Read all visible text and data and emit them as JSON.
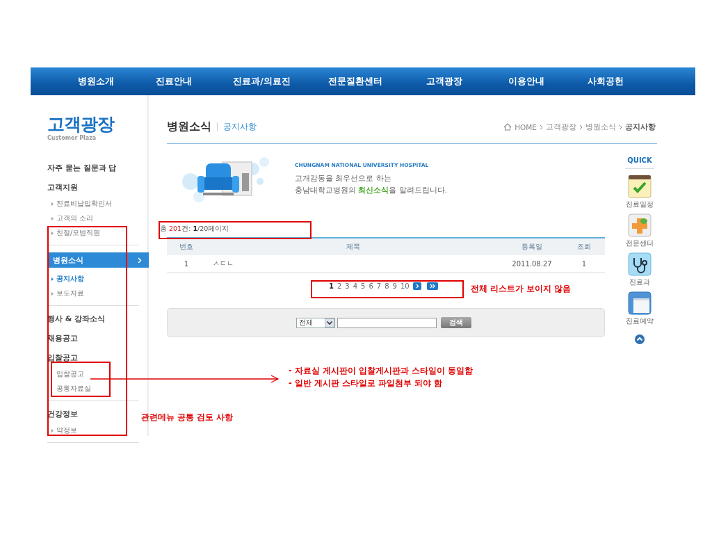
{
  "nav": [
    "병원소개",
    "진료안내",
    "진료과/의료진",
    "전문질환센터",
    "고객광장",
    "이용안내",
    "사회공헌"
  ],
  "sidebar": {
    "title": "고객광장",
    "subtitle": "Customer Plaza",
    "items": [
      {
        "label": "자주 묻는 질문과 답",
        "selected": false
      },
      {
        "label": "고객지원",
        "selected": false,
        "children": [
          {
            "label": "진료비납입확인서",
            "selected": false,
            "kind": "bullet"
          },
          {
            "label": "고객의 소리",
            "selected": false,
            "kind": "bullet"
          },
          {
            "label": "친절/모범직원",
            "selected": false,
            "kind": "bullet"
          }
        ]
      },
      {
        "label": "병원소식",
        "selected": true,
        "children": [
          {
            "label": "공지사항",
            "selected": true,
            "kind": "bullet"
          },
          {
            "label": "보도자료",
            "selected": false,
            "kind": "bullet"
          }
        ]
      },
      {
        "label": "행사 & 강좌소식",
        "selected": false
      },
      {
        "label": "채용공고",
        "selected": false
      },
      {
        "label": "입찰공고",
        "selected": false,
        "children": [
          {
            "label": "입찰공고",
            "selected": false,
            "kind": "plain"
          },
          {
            "label": "공통자료실",
            "selected": false,
            "kind": "plain"
          }
        ]
      },
      {
        "label": "건강정보",
        "selected": false,
        "children": [
          {
            "label": "약정보",
            "selected": false,
            "kind": "bullet"
          }
        ]
      }
    ]
  },
  "page_header": {
    "title": "병원소식",
    "subtitle": "공지사항",
    "breadcrumb": [
      "HOME",
      "고객광장",
      "병원소식",
      "공지사항"
    ]
  },
  "banner": {
    "eyebrow": "CHUNGNAM NATIONAL UNIVERSITY HOSPITAL",
    "lines": [
      "고개감동을 최우선으로 하는",
      "충남대학교병원의 **최신소식**을 알려드립니다."
    ]
  },
  "summary": "총 **201**건: **1**/20페이지",
  "table": {
    "columns": [
      "번호",
      "제목",
      "등록일",
      "조회"
    ],
    "rows": [
      [
        "1",
        "ㅅㄷㄴ",
        "2011.08.27",
        "1"
      ]
    ]
  },
  "pagination": {
    "pages": [
      {
        "label": "1",
        "selected": true
      },
      {
        "label": "2",
        "selected": false
      },
      {
        "label": "3",
        "selected": false
      },
      {
        "label": "4",
        "selected": false
      },
      {
        "label": "5",
        "selected": false
      },
      {
        "label": "6",
        "selected": false
      },
      {
        "label": "7",
        "selected": false
      },
      {
        "label": "8",
        "selected": false
      },
      {
        "label": "9",
        "selected": false
      },
      {
        "label": "10",
        "selected": false
      }
    ]
  },
  "search": {
    "scope": "전체",
    "button": "검색"
  },
  "quick": {
    "title": "QUICK",
    "items": [
      {
        "label": "진료일정",
        "kind": "calendar"
      },
      {
        "label": "전문센터",
        "kind": "cross"
      },
      {
        "label": "진료과",
        "kind": "stethoscope"
      },
      {
        "label": "진료예약",
        "kind": "window"
      }
    ]
  },
  "annotations": {
    "pagination_note": "전체 리스트가 보이지 않음",
    "menu_note": "관련메뉴 공통 검토 사항",
    "board_notes": [
      "- 자료실 게시판이 입찰게시판과 스타일이 동일함",
      "- 일반 게시판 스타일로 파일첨부 되야 함"
    ]
  }
}
